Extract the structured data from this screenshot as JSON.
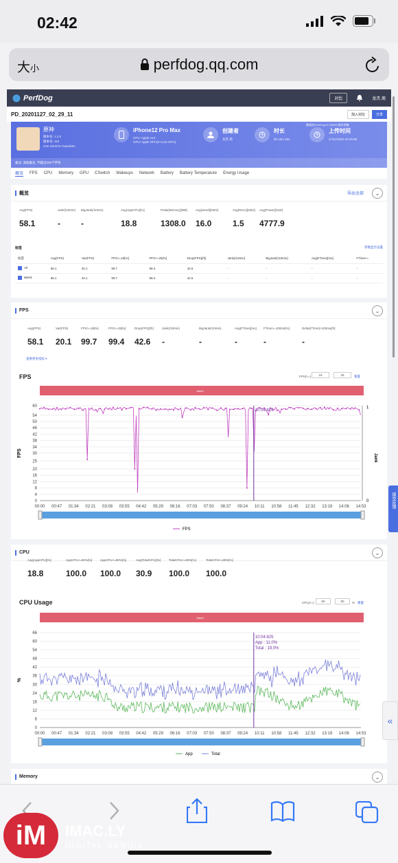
{
  "status": {
    "time": "02:42"
  },
  "browser": {
    "text_size": "大",
    "text_size_small": "小",
    "url": "perfdog.qq.com"
  },
  "app": {
    "logo": "PerfDog",
    "top_buttons": [
      "对比",
      "龙杰 周"
    ],
    "report_title": "PD_20201127_02_29_11",
    "report_buttons": [
      "加入对比",
      "分享"
    ],
    "game": {
      "name": "原神",
      "meta": [
        "版本号: 1.1.0",
        "版本号: 115",
        "com.miHoYo.Yuanshen"
      ]
    },
    "device": {
      "name": "iPhone12 Pro Max",
      "cpu": "CPU: Apple A14",
      "gpu": "GPU: Apple GPU(4-Core GPU)"
    },
    "creator": {
      "label": "创建者",
      "value": "龙杰 周"
    },
    "duration": {
      "label": "时长",
      "value": "0h 15m 30s"
    },
    "upload": {
      "label": "上传时间",
      "value": "27/11/2020 02:29:08",
      "note": "数据由PerfDog4.3.200901版本采集"
    },
    "note": "备注: 添加备注, 不超过200个字符",
    "tabs": [
      "概览",
      "FPS",
      "CPU",
      "Memory",
      "GPU",
      "CSwitch",
      "Wakeups",
      "Network",
      "Battery",
      "Battery Temperature",
      "Energy Usage"
    ]
  },
  "overview": {
    "title": "概览",
    "export": "导出全部",
    "stats": [
      {
        "label": "Avg(FPS)",
        "value": "58.1"
      },
      {
        "label": "Jank(/10min)",
        "value": "-"
      },
      {
        "label": "BigJank(/10min)",
        "value": "-"
      },
      {
        "label": "Avg(AppCPU)[%]",
        "value": "18.8"
      },
      {
        "label": "Peak(Memory)[MB]",
        "value": "1308.0"
      },
      {
        "label": "Avg(Send)[KB/s]",
        "value": "16.0"
      },
      {
        "label": "Avg(Recv)[KB/s]",
        "value": "1.5"
      },
      {
        "label": "Avg(Power)[mW]",
        "value": "4777.9"
      }
    ],
    "tags_title": "标签",
    "tags_link": "参数显示设置",
    "table": {
      "headers": [
        "标签",
        "Avg(FPS)",
        "Var(FPS)",
        "FPS>=18[%]",
        "FPS>=25[%]",
        "Drop(FPS)[/h]",
        "Jank(/10min)",
        "BigJank(/10min)",
        "Avg(FTime)[ms]",
        "FTime>="
      ],
      "rows": [
        [
          "All",
          "58.1",
          "20.1",
          "99.7",
          "99.4",
          "42.6",
          "-",
          "-",
          "-",
          "-"
        ],
        [
          "label1",
          "58.1",
          "20.1",
          "99.7",
          "99.4",
          "42.6",
          "-",
          "-",
          "-",
          "-"
        ]
      ]
    }
  },
  "fps": {
    "title": "FPS",
    "stats": [
      {
        "label": "Avg(FPS)",
        "value": "58.1"
      },
      {
        "label": "Var(FPS)",
        "value": "20.1"
      },
      {
        "label": "FPS>=18[%]",
        "value": "99.7"
      },
      {
        "label": "FPS>=25[%]",
        "value": "99.4"
      },
      {
        "label": "Drop(FPS)[/h]",
        "value": "42.6"
      },
      {
        "label": "Jank(/10min)",
        "value": "-"
      },
      {
        "label": "BigJank(/10min)",
        "value": "-"
      },
      {
        "label": "Avg(FTime)[ms]",
        "value": "-"
      },
      {
        "label": "FTime>=100ms[%]",
        "value": "-"
      },
      {
        "label": "Delta(FTime)>100ms[/h]",
        "value": "-"
      }
    ],
    "more": "查看更多指标",
    "chart_title": "FPS",
    "threshold_label": "FPS(>=)",
    "threshold_values": [
      "18",
      "25"
    ],
    "reset": "重置",
    "label_bar": "label1",
    "cursor": "10:04:825",
    "right_axis": "Jank",
    "legend": "FPS"
  },
  "cpu": {
    "title": "CPU",
    "stats": [
      {
        "label": "Avg(AppCPU)[%]",
        "value": "18.8"
      },
      {
        "label": "AppCPU<=60%[%]",
        "value": "100.0"
      },
      {
        "label": "AppCPU<=80%[%]",
        "value": "100.0"
      },
      {
        "label": "Avg(TotalCPU)[%]",
        "value": "30.9"
      },
      {
        "label": "TotalCPU<=60%[%]",
        "value": "100.0"
      },
      {
        "label": "TotalCPU<=80%[%]",
        "value": "100.0"
      }
    ],
    "chart_title": "CPU Usage",
    "threshold_label": "CPU(<=)",
    "threshold_values": [
      "60",
      "80"
    ],
    "unit": "%",
    "reset": "重置",
    "label_bar": "label1",
    "cursor": "10:04:825",
    "cursor_app": "App : 11.0%",
    "cursor_total": "Total : 19.0%",
    "legend": [
      "App",
      "Total"
    ]
  },
  "memory": {
    "title": "Memory"
  },
  "watermark": {
    "logo": "iM",
    "brand": "IMAC.LY",
    "tag": "DIGITAL GENIUS"
  },
  "sidebar": {
    "feedback": "提交反馈"
  },
  "colors": {
    "accent": "#4a6ee0",
    "fps_line": "#c040c0",
    "app_line": "#5cb85c",
    "total_line": "#7a7fd8",
    "label_bar": "#e06070"
  },
  "chart_data": [
    {
      "type": "line",
      "title": "FPS",
      "ylabel": "FPS",
      "y2label": "Jank",
      "ylim": [
        0,
        60
      ],
      "y2lim": [
        0,
        1
      ],
      "yticks": [
        0,
        4,
        8,
        12,
        16,
        20,
        25,
        30,
        34,
        38,
        42,
        46,
        50,
        54,
        60
      ],
      "xticks": [
        "00:00",
        "00:47",
        "01:34",
        "02:21",
        "03:08",
        "03:55",
        "04:42",
        "05:29",
        "06:16",
        "07:03",
        "07:50",
        "08:37",
        "09:24",
        "10:11",
        "10:58",
        "11:45",
        "12:32",
        "13:19",
        "14:06",
        "14:53"
      ],
      "series": [
        {
          "name": "FPS",
          "approx_baseline": 59,
          "dips": [
            {
              "t": "02:12",
              "v": 26
            },
            {
              "t": "04:25",
              "v": 20
            },
            {
              "t": "04:30",
              "v": 5
            },
            {
              "t": "08:45",
              "v": 40
            },
            {
              "t": "09:35",
              "v": 8
            },
            {
              "t": "09:55",
              "v": 31
            }
          ]
        }
      ]
    },
    {
      "type": "line",
      "title": "CPU Usage",
      "ylabel": "%",
      "ylim": [
        0,
        66
      ],
      "yticks": [
        0,
        6,
        12,
        18,
        24,
        30,
        36,
        42,
        48,
        54,
        60,
        66
      ],
      "xticks": [
        "00:00",
        "00:47",
        "01:34",
        "02:21",
        "03:08",
        "03:55",
        "04:42",
        "05:29",
        "06:16",
        "07:03",
        "07:50",
        "08:37",
        "09:24",
        "10:11",
        "10:58",
        "11:45",
        "12:32",
        "13:19",
        "14:06",
        "14:53"
      ],
      "series": [
        {
          "name": "App",
          "approx_mean": 18.8
        },
        {
          "name": "Total",
          "approx_mean": 30.9
        }
      ]
    }
  ]
}
